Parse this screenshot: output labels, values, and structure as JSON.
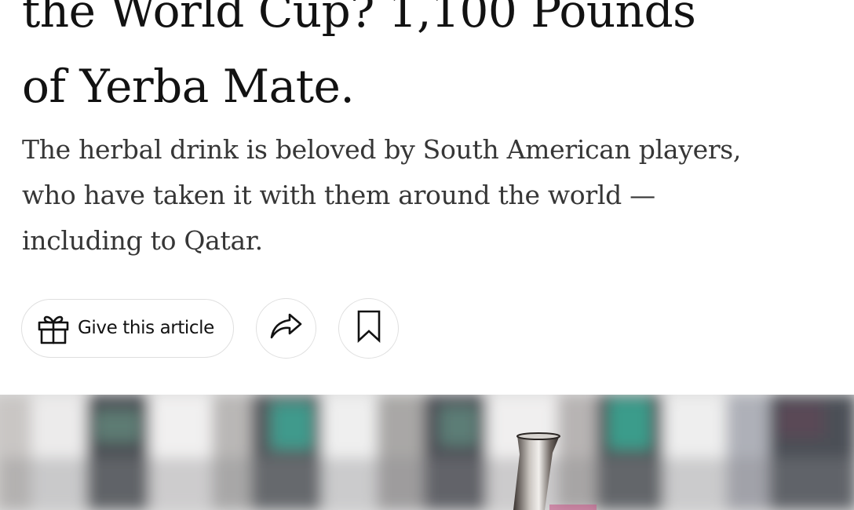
{
  "article": {
    "headline_lines": [
      "the World Cup? 1,100 Pounds",
      "of Yerba Mate."
    ],
    "summary_lines": [
      "The herbal drink is beloved by South American players,",
      "who have taken it with them around the world —",
      "including to Qatar."
    ]
  },
  "actions": {
    "gift_label": "Give this article",
    "gift_icon": "gift-icon",
    "share_icon": "share-icon",
    "save_icon": "bookmark-icon"
  },
  "colors": {
    "headline": "#121212",
    "summary": "#363636",
    "button_border": "#dfdfdf"
  }
}
